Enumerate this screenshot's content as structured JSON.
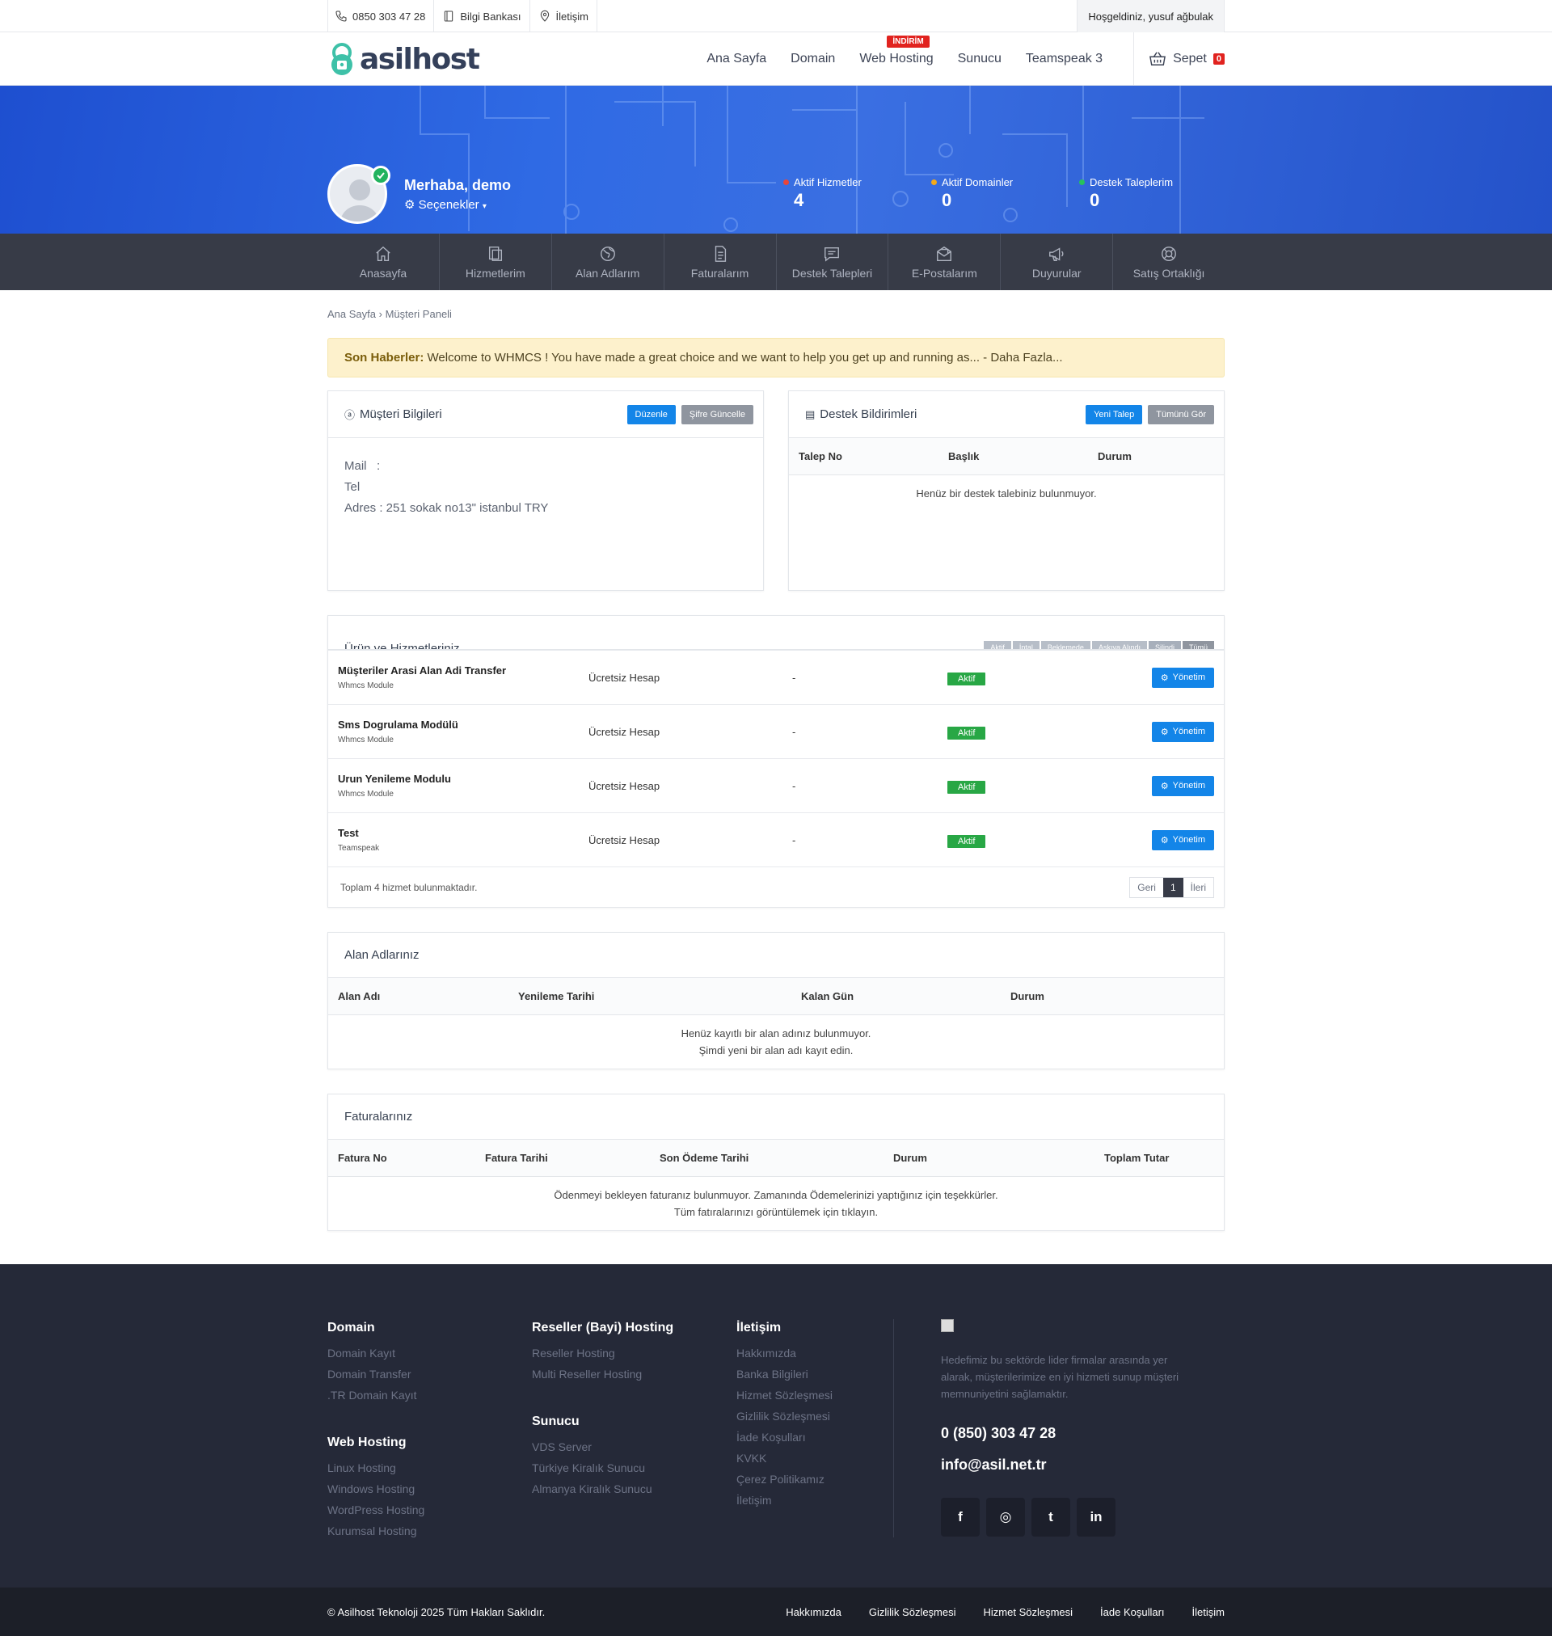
{
  "topbar": {
    "phone": "0850 303 47 28",
    "bank": "Bilgi Bankası",
    "contact": "İletişim",
    "welcome": "Hoşgeldiniz, yusuf ağbulak"
  },
  "header": {
    "logo": "asilhost",
    "nav": [
      "Ana Sayfa",
      "Domain",
      "Web Hosting",
      "Sunucu",
      "Teamspeak 3"
    ],
    "discount_badge": "İNDİRİM",
    "cart_label": "Sepet",
    "cart_count": "0"
  },
  "hero": {
    "greeting": "Merhaba, demo",
    "options": "Seçenekler",
    "stats": [
      {
        "label": "Aktif Hizmetler",
        "value": "4",
        "color": "#e8463b"
      },
      {
        "label": "Aktif Domainler",
        "value": "0",
        "color": "#f2a91a"
      },
      {
        "label": "Destek Taleplerim",
        "value": "0",
        "color": "#27c25c"
      }
    ]
  },
  "icon_nav": [
    {
      "label": "Anasayfa",
      "icon": "home-icon"
    },
    {
      "label": "Hizmetlerim",
      "icon": "copy-icon"
    },
    {
      "label": "Alan Adlarım",
      "icon": "globe-icon"
    },
    {
      "label": "Faturalarım",
      "icon": "document-icon"
    },
    {
      "label": "Destek Talepleri",
      "icon": "chat-icon"
    },
    {
      "label": "E-Postalarım",
      "icon": "mail-icon"
    },
    {
      "label": "Duyurular",
      "icon": "megaphone-icon"
    },
    {
      "label": "Satış Ortaklığı",
      "icon": "lifebuoy-icon"
    }
  ],
  "breadcrumb": {
    "home": "Ana Sayfa",
    "current": "Müşteri Paneli"
  },
  "news": {
    "label": "Son Haberler:",
    "text": "Welcome to WHMCS ! You have made a great choice and we want to help you get up and running as... - Daha Fazla..."
  },
  "customer": {
    "title": "Müşteri Bilgileri",
    "edit": "Düzenle",
    "password": "Şifre Güncelle",
    "mail": "Mail   :",
    "tel": "Tel",
    "address": "Adres : 251 sokak no13\" istanbul TRY"
  },
  "support": {
    "title": "Destek Bildirimleri",
    "new": "Yeni Talep",
    "all": "Tümünü Gör",
    "cols": [
      "Talep No",
      "Başlık",
      "Durum"
    ],
    "empty": "Henüz bir destek talebiniz bulunmuyor."
  },
  "services": {
    "title": "Ürün ve Hizmetleriniz",
    "filters": [
      "Aktif",
      "İptal",
      "Beklemede",
      "Askıya Alındı",
      "Silindi",
      "Tümü"
    ],
    "rows": [
      {
        "name": "Müşteriler Arasi Alan Adi Transfer",
        "module": "Whmcs Module",
        "plan": "Ücretsiz Hesap",
        "price": "-",
        "status": "Aktif",
        "action": "Yönetim"
      },
      {
        "name": "Sms Dogrulama Modülü",
        "module": "Whmcs Module",
        "plan": "Ücretsiz Hesap",
        "price": "-",
        "status": "Aktif",
        "action": "Yönetim"
      },
      {
        "name": "Urun Yenileme Modulu",
        "module": "Whmcs Module",
        "plan": "Ücretsiz Hesap",
        "price": "-",
        "status": "Aktif",
        "action": "Yönetim"
      },
      {
        "name": "Test",
        "module": "Teamspeak",
        "plan": "Ücretsiz Hesap",
        "price": "-",
        "status": "Aktif",
        "action": "Yönetim"
      }
    ],
    "total": "Toplam 4 hizmet bulunmaktadır.",
    "prev": "Geri",
    "page": "1",
    "next": "İleri"
  },
  "domains": {
    "title": "Alan Adlarınız",
    "cols": [
      "Alan Adı",
      "Yenileme Tarihi",
      "Kalan Gün",
      "Durum"
    ],
    "empty1": "Henüz kayıtlı bir alan adınız bulunmuyor.",
    "empty2": "Şimdi yeni bir alan adı kayıt edin."
  },
  "invoices": {
    "title": "Faturalarınız",
    "cols": [
      "Fatura No",
      "Fatura Tarihi",
      "Son Ödeme Tarihi",
      "Durum",
      "Toplam Tutar"
    ],
    "empty1": "Ödenmeyi bekleyen faturanız bulunmuyor. Zamanında Ödemelerinizi yaptığınız için teşekkürler.",
    "empty2": "Tüm fatıralarınızı görüntülemek için tıklayın."
  },
  "footer": {
    "domain": {
      "title": "Domain",
      "links": [
        "Domain Kayıt",
        "Domain Transfer",
        ".TR Domain Kayıt"
      ]
    },
    "webhosting": {
      "title": "Web Hosting",
      "links": [
        "Linux Hosting",
        "Windows Hosting",
        "WordPress Hosting",
        "Kurumsal Hosting"
      ]
    },
    "reseller": {
      "title": "Reseller (Bayi) Hosting",
      "links": [
        "Reseller Hosting",
        "Multi Reseller Hosting"
      ]
    },
    "server": {
      "title": "Sunucu",
      "links": [
        "VDS Server",
        "Türkiye Kiralık Sunucu",
        "Almanya Kiralık Sunucu"
      ]
    },
    "contact": {
      "title": "İletişim",
      "links": [
        "Hakkımızda",
        "Banka Bilgileri",
        "Hizmet Sözleşmesi",
        "Gizlilik Sözleşmesi",
        "İade Koşulları",
        "KVKK",
        "Çerez Politikamız",
        "İletişim"
      ]
    },
    "desc": "Hedefimiz bu sektörde lider firmalar arasında yer alarak, müşterilerimize en iyi hizmeti sunup müşteri memnuniyetini sağlamaktır.",
    "phone": "0 (850) 303 47 28",
    "email": "info@asil.net.tr",
    "social": [
      {
        "icon": "facebook-icon",
        "glyph": "f"
      },
      {
        "icon": "instagram-icon",
        "glyph": "◎"
      },
      {
        "icon": "twitter-icon",
        "glyph": "t"
      },
      {
        "icon": "linkedin-icon",
        "glyph": "in"
      }
    ]
  },
  "copyright": {
    "text": "© Asilhost Teknoloji 2025 Tüm Hakları Saklıdır.",
    "links": [
      "Hakkımızda",
      "Gizlilik Sözleşmesi",
      "Hizmet Sözleşmesi",
      "İade Koşulları",
      "İletişim"
    ]
  }
}
